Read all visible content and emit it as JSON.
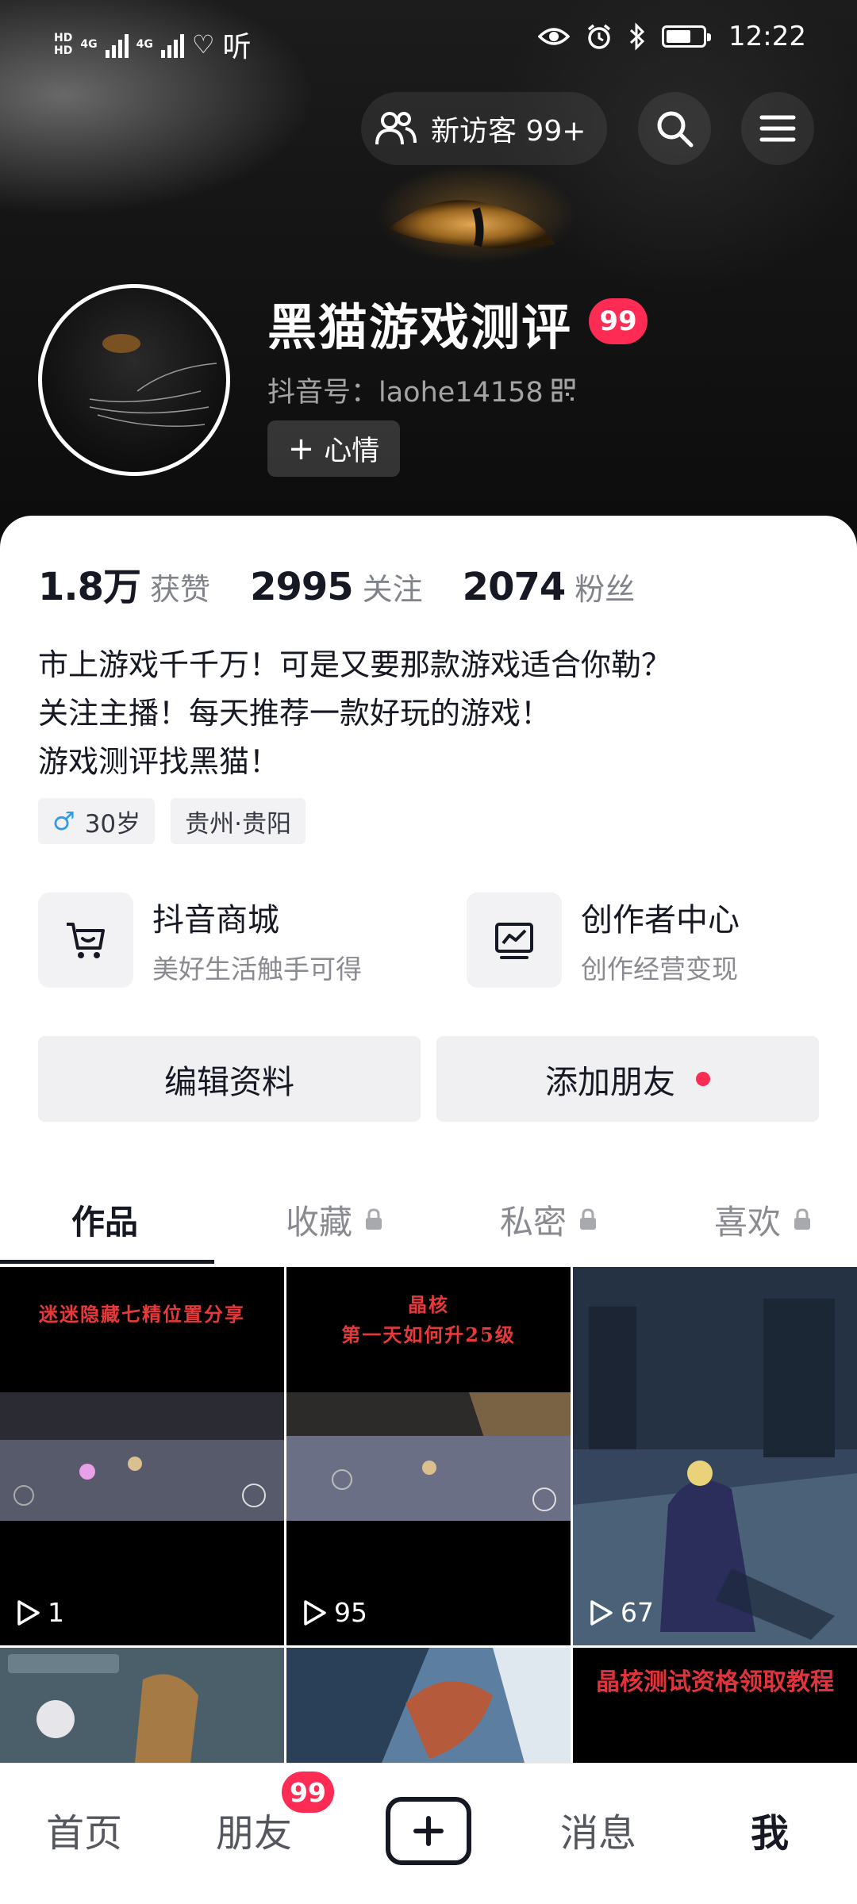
{
  "status_bar": {
    "network_1": "4G",
    "network_2": "4G",
    "listen": "听",
    "time": "12:22"
  },
  "header": {
    "visitor_label": "新访客 99+",
    "search_icon": "search-icon",
    "menu_icon": "hamburger-icon"
  },
  "profile": {
    "nickname": "黑猫游戏测评",
    "badge": "99",
    "douyin_id": "抖音号：laohe14158",
    "mood_label": "心情"
  },
  "stats": [
    {
      "value": "1.8万",
      "label": "获赞"
    },
    {
      "value": "2995",
      "label": "关注"
    },
    {
      "value": "2074",
      "label": "粉丝"
    }
  ],
  "bio": {
    "line1": "市上游戏千千万！可是又要那款游戏适合你勒？",
    "line2": "关注主播！每天推荐一款好玩的游戏！",
    "line3": "游戏测评找黑猫！"
  },
  "tags": {
    "gender_symbol": "♂",
    "age": "30岁",
    "location": "贵州·贵阳"
  },
  "services": [
    {
      "title": "抖音商城",
      "subtitle": "美好生活触手可得",
      "icon": "cart-icon"
    },
    {
      "title": "创作者中心",
      "subtitle": "创作经营变现",
      "icon": "analytics-icon"
    }
  ],
  "actions": {
    "edit_profile": "编辑资料",
    "add_friend": "添加朋友"
  },
  "tabs": [
    {
      "label": "作品",
      "locked": false
    },
    {
      "label": "收藏",
      "locked": true
    },
    {
      "label": "私密",
      "locked": true
    },
    {
      "label": "喜欢",
      "locked": true
    }
  ],
  "videos": [
    {
      "caption": "迷迷隐藏七精位置分享",
      "plays": "1"
    },
    {
      "caption_line1": "晶核",
      "caption_line2": "第一天如何升25级",
      "plays": "95"
    },
    {
      "caption": "",
      "plays": "67"
    },
    {
      "caption": "",
      "plays": ""
    },
    {
      "caption": "",
      "plays": ""
    },
    {
      "caption": "晶核测试资格领取教程",
      "plays": ""
    }
  ],
  "bottom_nav": {
    "home": "首页",
    "friends": "朋友",
    "friends_badge": "99",
    "messages": "消息",
    "me": "我"
  },
  "colors": {
    "accent": "#fe2c55",
    "text_primary": "#161823",
    "text_secondary": "#8a8b91"
  }
}
